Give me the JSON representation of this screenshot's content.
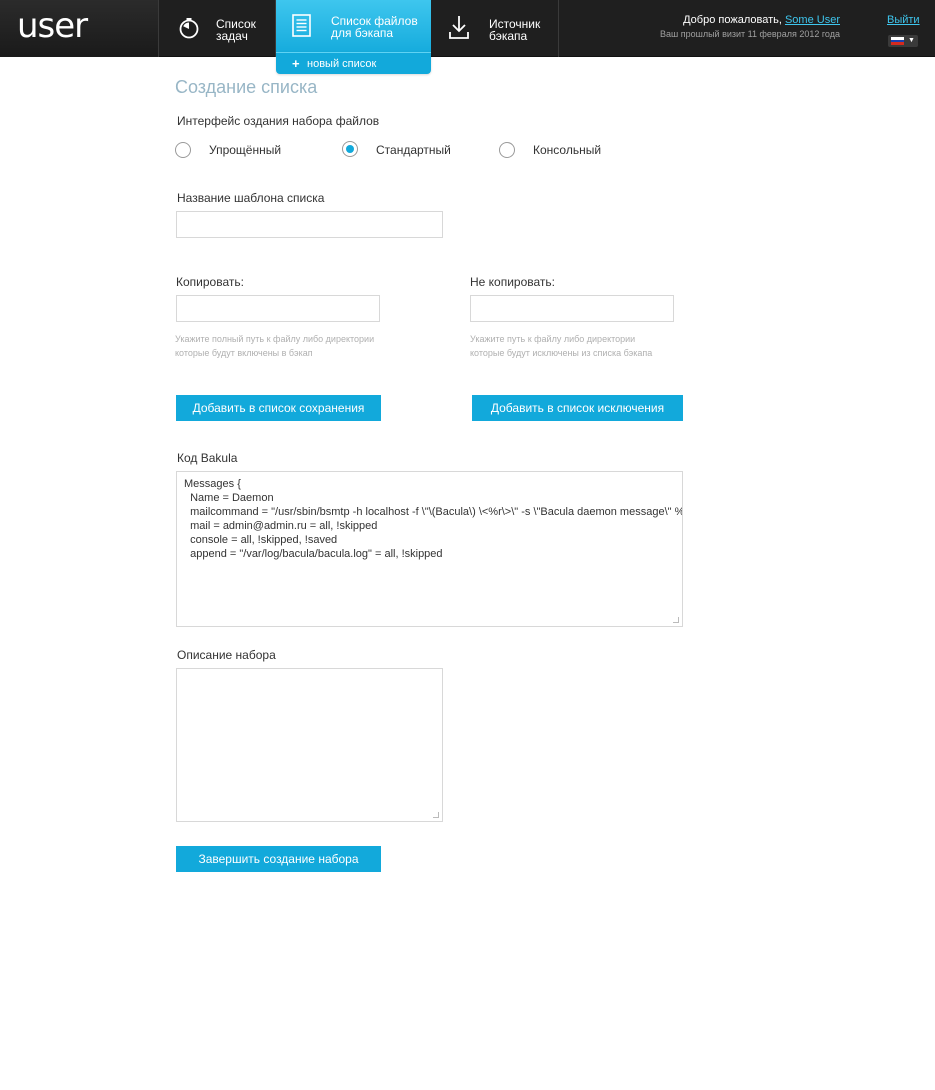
{
  "header": {
    "logo": "user",
    "nav": [
      {
        "label": "Список\nзадач",
        "icon": "stopwatch-icon"
      },
      {
        "label": "Список файлов\nдля бэкапа",
        "icon": "document-list-icon"
      },
      {
        "label": "Источник\nбэкапа",
        "icon": "download-icon"
      }
    ],
    "subnav_label": "новый список",
    "welcome_prefix": "Добро пожаловать, ",
    "username": "Some User",
    "last_visit": "Ваш прошлый визит 11 февраля 2012 года",
    "logout": "Выйти",
    "language": "ru"
  },
  "main": {
    "title": "Создание списка",
    "interface_label": "Интерфейс оздания набора файлов",
    "interface_options": [
      {
        "label": "Упрощённый",
        "checked": false
      },
      {
        "label": "Стандартный",
        "checked": true
      },
      {
        "label": "Консольный",
        "checked": false
      }
    ],
    "template_name_label": "Название шаблона списка",
    "template_name_value": "",
    "copy_label": "Копировать:",
    "copy_value": "",
    "copy_hint": "Укажите полный путь к файлу либо директории которые будут включены в бэкап",
    "nocopy_label": "Не копировать:",
    "nocopy_value": "",
    "nocopy_hint": "Укажите путь к файлу либо директории которые будут исключены из списка бэкапа",
    "add_include_button": "Добавить в список сохранения",
    "add_exclude_button": "Добавить в список исключения",
    "bacula_label": "Код Bakula",
    "bacula_code": "Messages {\n  Name = Daemon\n  mailcommand = \"/usr/sbin/bsmtp -h localhost -f \\\"\\(Bacula\\) \\<%r\\>\\\" -s \\\"Bacula daemon message\\\" %r\"\n  mail = admin@admin.ru = all, !skipped\n  console = all, !skipped, !saved\n  append = \"/var/log/bacula/bacula.log\" = all, !skipped",
    "description_label": "Описание набора",
    "description_value": "",
    "finish_button": "Завершить создание набора"
  },
  "colors": {
    "accent": "#12a9db",
    "header_bg": "#1f1f1f",
    "title": "#98b6c6"
  }
}
